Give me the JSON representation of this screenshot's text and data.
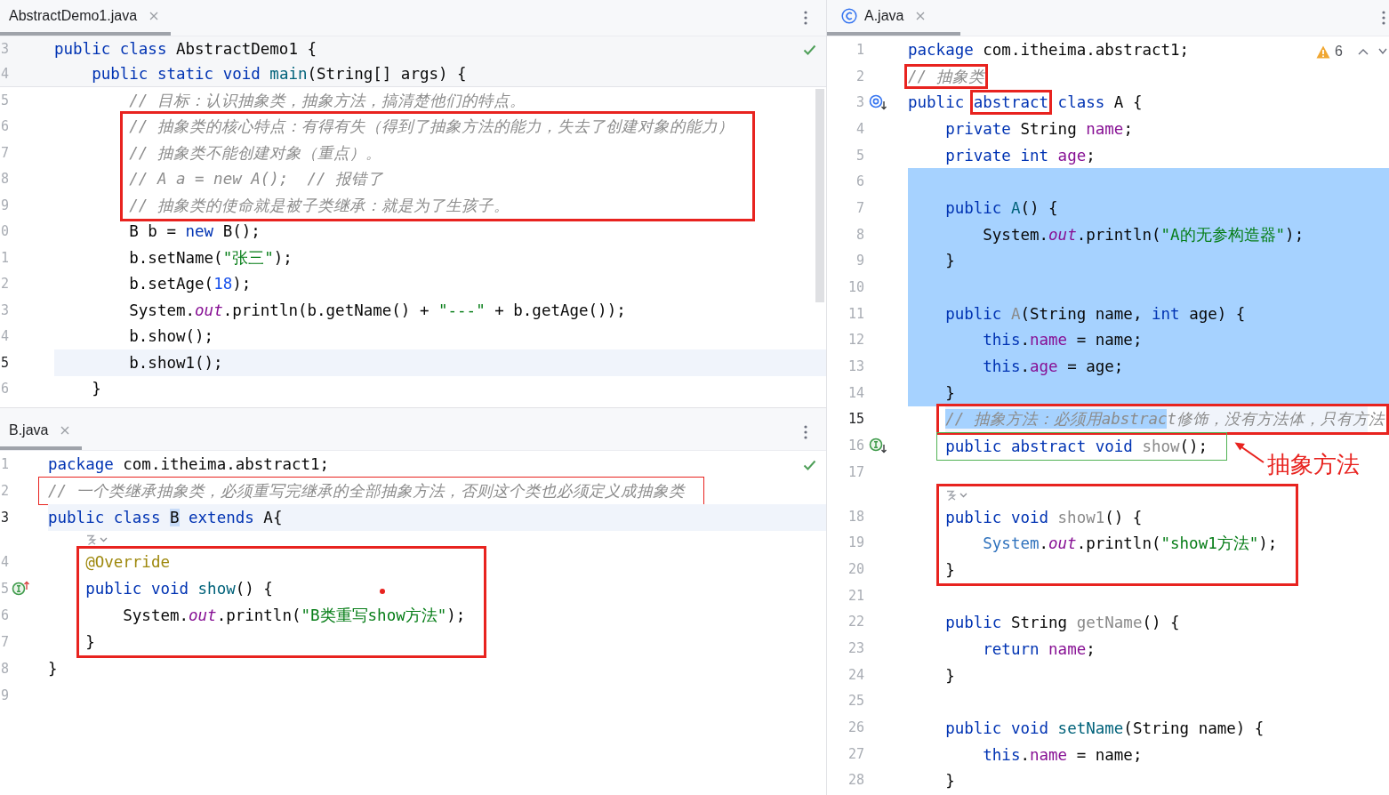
{
  "left_pane": {
    "editors": [
      {
        "tabs": [
          {
            "label": "AbstractDemo1.java",
            "selected": true
          }
        ],
        "inspection": {
          "kind": "ok"
        },
        "sticky_lines": [
          {
            "kind": "code",
            "number": "3",
            "tokens": [
              {
                "kind": "keyword",
                "text": "public class"
              },
              {
                "kind": "plain",
                "text": " AbstractDemo1 {"
              }
            ]
          },
          {
            "kind": "code",
            "number": "4",
            "tokens": [
              {
                "kind": "keyword",
                "text": "    public static void "
              },
              {
                "kind": "declaration",
                "text": "main"
              },
              {
                "kind": "plain",
                "text": "(String[] args) {"
              }
            ]
          }
        ],
        "lines": [
          {
            "kind": "code",
            "number": "5",
            "current": false,
            "tokens": [
              {
                "kind": "comment",
                "text": "        // 目标：认识抽象类，抽象方法，搞清楚他们的特点。"
              }
            ]
          },
          {
            "kind": "frame",
            "color": "#e8231f",
            "lines": [
              {
                "kind": "code",
                "number": "6",
                "current": false,
                "tokens": [
                  {
                    "kind": "comment",
                    "text": "        // 抽象类的核心特点：有得有失（得到了抽象方法的能力，失去了创建对象的能力）"
                  }
                ]
              },
              {
                "kind": "code",
                "number": "7",
                "current": false,
                "tokens": [
                  {
                    "kind": "comment",
                    "text": "        // 抽象类不能创建对象（重点）。"
                  }
                ]
              },
              {
                "kind": "code",
                "number": "8",
                "current": false,
                "tokens": [
                  {
                    "kind": "comment",
                    "text": "        // A a = new A();  // 报错了"
                  }
                ]
              },
              {
                "kind": "code",
                "number": "9",
                "current": false,
                "tokens": [
                  {
                    "kind": "comment",
                    "text": "        // 抽象类的使命就是被子类继承：就是为了生孩子。"
                  }
                ]
              }
            ]
          },
          {
            "kind": "code",
            "number": "0",
            "current": false,
            "tokens": [
              {
                "kind": "plain",
                "text": "        B b = "
              },
              {
                "kind": "keyword",
                "text": "new"
              },
              {
                "kind": "plain",
                "text": " B();"
              }
            ]
          },
          {
            "kind": "code",
            "number": "1",
            "current": false,
            "tokens": [
              {
                "kind": "plain",
                "text": "        b.setName("
              },
              {
                "kind": "string",
                "text": "\"张三\""
              },
              {
                "kind": "plain",
                "text": ");"
              }
            ]
          },
          {
            "kind": "code",
            "number": "2",
            "current": false,
            "tokens": [
              {
                "kind": "plain",
                "text": "        b.setAge("
              },
              {
                "kind": "number",
                "text": "18"
              },
              {
                "kind": "plain",
                "text": ");"
              }
            ]
          },
          {
            "kind": "code",
            "number": "3",
            "current": false,
            "tokens": [
              {
                "kind": "plain",
                "text": "        System."
              },
              {
                "kind": "static-field",
                "text": "out"
              },
              {
                "kind": "plain",
                "text": ".println(b.getName() + "
              },
              {
                "kind": "string",
                "text": "\"---\""
              },
              {
                "kind": "plain",
                "text": " + b.getAge());"
              }
            ]
          },
          {
            "kind": "code",
            "number": "4",
            "current": false,
            "tokens": [
              {
                "kind": "plain",
                "text": "        b.show();"
              }
            ]
          },
          {
            "kind": "code",
            "number": "5",
            "current": true,
            "tokens": [
              {
                "kind": "plain",
                "text": "        b.show1();"
              }
            ]
          },
          {
            "kind": "code",
            "number": "6",
            "current": false,
            "tokens": [
              {
                "kind": "plain",
                "text": "    }"
              }
            ]
          }
        ]
      },
      {
        "tabs": [
          {
            "label": "B.java",
            "selected": true
          }
        ],
        "inspection": {
          "kind": "ok"
        },
        "lines": [
          {
            "kind": "code",
            "number": "1",
            "current": false,
            "tokens": [
              {
                "kind": "keyword",
                "text": "package"
              },
              {
                "kind": "plain",
                "text": " com.itheima.abstract1;"
              }
            ]
          },
          {
            "kind": "outline",
            "color": "#e8231f",
            "lines": [
              {
                "kind": "code",
                "number": "2",
                "current": false,
                "tokens": [
                  {
                    "kind": "comment",
                    "text": "// 一个类继承抽象类，必须重写完继承的全部抽象方法，否则这个类也必须定义成抽象类"
                  }
                ]
              }
            ]
          },
          {
            "kind": "code",
            "number": "3",
            "current": true,
            "tokens": [
              {
                "kind": "keyword",
                "text": "public class "
              },
              {
                "kind": "caret-word",
                "text": "B"
              },
              {
                "kind": "keyword",
                "text": " extends"
              },
              {
                "kind": "plain",
                "text": " A{"
              }
            ]
          },
          {
            "kind": "hint",
            "current": false
          },
          {
            "kind": "frame",
            "color": "#e8231f",
            "lines": [
              {
                "kind": "code",
                "number": "4",
                "current": false,
                "tokens": [
                  {
                    "kind": "annotation",
                    "text": "    @Override"
                  }
                ]
              },
              {
                "kind": "code",
                "number": "5",
                "current": false,
                "marker": {
                  "kind": "implements"
                },
                "tokens": [
                  {
                    "kind": "keyword",
                    "text": "    public void "
                  },
                  {
                    "kind": "declaration",
                    "text": "show"
                  },
                  {
                    "kind": "plain",
                    "text": "() {"
                  }
                ]
              },
              {
                "kind": "code",
                "number": "6",
                "current": false,
                "tokens": [
                  {
                    "kind": "plain",
                    "text": "        System."
                  },
                  {
                    "kind": "static-field",
                    "text": "out"
                  },
                  {
                    "kind": "plain",
                    "text": ".println("
                  },
                  {
                    "kind": "string",
                    "text": "\"B类重写show方法\""
                  },
                  {
                    "kind": "plain",
                    "text": ");"
                  }
                ]
              },
              {
                "kind": "code",
                "number": "7",
                "current": false,
                "tokens": [
                  {
                    "kind": "plain",
                    "text": "    }"
                  }
                ]
              }
            ]
          },
          {
            "kind": "code",
            "number": "8",
            "current": false,
            "tokens": [
              {
                "kind": "plain",
                "text": "}"
              }
            ]
          },
          {
            "kind": "code",
            "number": "9",
            "current": false
          }
        ]
      }
    ]
  },
  "right_pane": {
    "editors": [
      {
        "tabs": [
          {
            "label": "A.java",
            "selected": true,
            "icon": {
              "kind": "class"
            }
          }
        ],
        "inspection": {
          "kind": "warnings",
          "count": "6"
        },
        "lines": [
          {
            "kind": "code",
            "number": "1",
            "current": false,
            "selected": false,
            "tokens": [
              {
                "kind": "keyword",
                "text": "package"
              },
              {
                "kind": "plain",
                "text": " com.itheima.abstract1;"
              }
            ]
          },
          {
            "kind": "code",
            "number": "2",
            "current": false,
            "selected": false,
            "tokens": [
              {
                "kind": "frame",
                "color": "#e8231f",
                "tokens": [
                  {
                    "kind": "comment",
                    "text": "// 抽象类"
                  }
                ]
              }
            ]
          },
          {
            "kind": "code",
            "number": "3",
            "current": false,
            "selected": false,
            "marker": {
              "kind": "subclassed"
            },
            "tokens": [
              {
                "kind": "keyword",
                "text": "public "
              },
              {
                "kind": "frame",
                "color": "#e8231f",
                "tokens": [
                  {
                    "kind": "keyword",
                    "text": "abstract"
                  }
                ]
              },
              {
                "kind": "keyword",
                "text": " class"
              },
              {
                "kind": "plain",
                "text": " A {"
              }
            ]
          },
          {
            "kind": "code",
            "number": "4",
            "current": false,
            "selected": false,
            "tokens": [
              {
                "kind": "keyword",
                "text": "    private"
              },
              {
                "kind": "plain",
                "text": " String "
              },
              {
                "kind": "field",
                "text": "name"
              },
              {
                "kind": "plain",
                "text": ";"
              }
            ]
          },
          {
            "kind": "code",
            "number": "5",
            "current": false,
            "selected": false,
            "tokens": [
              {
                "kind": "keyword",
                "text": "    private int "
              },
              {
                "kind": "field",
                "text": "age"
              },
              {
                "kind": "plain",
                "text": ";"
              }
            ]
          },
          {
            "kind": "code",
            "number": "6",
            "current": false,
            "selected": true
          },
          {
            "kind": "code",
            "number": "7",
            "current": false,
            "selected": true,
            "tokens": [
              {
                "kind": "keyword",
                "text": "    public "
              },
              {
                "kind": "declaration",
                "text": "A"
              },
              {
                "kind": "plain",
                "text": "() {"
              }
            ]
          },
          {
            "kind": "code",
            "number": "8",
            "current": false,
            "selected": true,
            "tokens": [
              {
                "kind": "plain",
                "text": "        System."
              },
              {
                "kind": "static-field",
                "text": "out"
              },
              {
                "kind": "plain",
                "text": ".println("
              },
              {
                "kind": "string",
                "text": "\"A的无参构造器\""
              },
              {
                "kind": "plain",
                "text": ");"
              }
            ]
          },
          {
            "kind": "code",
            "number": "9",
            "current": false,
            "selected": true,
            "tokens": [
              {
                "kind": "plain",
                "text": "    }"
              }
            ]
          },
          {
            "kind": "code",
            "number": "10",
            "current": false,
            "selected": true
          },
          {
            "kind": "code",
            "number": "11",
            "current": false,
            "selected": true,
            "tokens": [
              {
                "kind": "keyword",
                "text": "    public "
              },
              {
                "kind": "unused",
                "text": "A"
              },
              {
                "kind": "plain",
                "text": "(String name, "
              },
              {
                "kind": "keyword",
                "text": "int"
              },
              {
                "kind": "plain",
                "text": " age) {"
              }
            ]
          },
          {
            "kind": "code",
            "number": "12",
            "current": false,
            "selected": true,
            "tokens": [
              {
                "kind": "keyword",
                "text": "        this"
              },
              {
                "kind": "plain",
                "text": "."
              },
              {
                "kind": "field",
                "text": "name"
              },
              {
                "kind": "plain",
                "text": " = name;"
              }
            ]
          },
          {
            "kind": "code",
            "number": "13",
            "current": false,
            "selected": true,
            "tokens": [
              {
                "kind": "keyword",
                "text": "        this"
              },
              {
                "kind": "plain",
                "text": "."
              },
              {
                "kind": "field",
                "text": "age"
              },
              {
                "kind": "plain",
                "text": " = age;"
              }
            ]
          },
          {
            "kind": "code",
            "number": "14",
            "current": false,
            "selected": true,
            "tokens": [
              {
                "kind": "plain",
                "text": "    }"
              }
            ]
          },
          {
            "kind": "frame",
            "color": "#e8231f",
            "lines": [
              {
                "kind": "code",
                "number": "15",
                "current": true,
                "selected": false,
                "tokens": [
                  {
                    "kind": "comment",
                    "text": "    // 抽象方法：必须用abstrac",
                    "selected": true
                  },
                  {
                    "kind": "comment",
                    "text": "t修饰，没有方法体，只有方法",
                    "selected": false
                  }
                ]
              }
            ]
          },
          {
            "kind": "outline",
            "color": "#52b355",
            "lines": [
              {
                "kind": "code",
                "number": "16",
                "current": false,
                "selected": false,
                "marker": {
                  "kind": "implemented"
                },
                "tokens": [
                  {
                    "kind": "keyword",
                    "text": "    public abstract void "
                  },
                  {
                    "kind": "unused",
                    "text": "show"
                  },
                  {
                    "kind": "plain",
                    "text": "();"
                  }
                ]
              }
            ]
          },
          {
            "kind": "code",
            "number": "17",
            "current": false,
            "selected": false
          },
          {
            "kind": "frame",
            "color": "#e8231f",
            "lines": [
              {
                "kind": "hint",
                "current": false,
                "selected": false
              },
              {
                "kind": "code",
                "number": "18",
                "current": false,
                "selected": false,
                "tokens": [
                  {
                    "kind": "keyword",
                    "text": "    public void "
                  },
                  {
                    "kind": "unused",
                    "text": "show1"
                  },
                  {
                    "kind": "plain",
                    "text": "() {"
                  }
                ]
              },
              {
                "kind": "code",
                "number": "19",
                "current": false,
                "selected": false,
                "tokens": [
                  {
                    "kind": "usage",
                    "text": "        System"
                  },
                  {
                    "kind": "plain",
                    "text": "."
                  },
                  {
                    "kind": "static-field",
                    "text": "out"
                  },
                  {
                    "kind": "plain",
                    "text": ".println("
                  },
                  {
                    "kind": "string",
                    "text": "\"show1方法\""
                  },
                  {
                    "kind": "plain",
                    "text": ");"
                  }
                ]
              },
              {
                "kind": "code",
                "number": "20",
                "current": false,
                "selected": false,
                "tokens": [
                  {
                    "kind": "plain",
                    "text": "    }"
                  }
                ]
              }
            ]
          },
          {
            "kind": "code",
            "number": "21",
            "current": false,
            "selected": false
          },
          {
            "kind": "code",
            "number": "22",
            "current": false,
            "selected": false,
            "tokens": [
              {
                "kind": "keyword",
                "text": "    public"
              },
              {
                "kind": "plain",
                "text": " String "
              },
              {
                "kind": "unused",
                "text": "getName"
              },
              {
                "kind": "plain",
                "text": "() {"
              }
            ]
          },
          {
            "kind": "code",
            "number": "23",
            "current": false,
            "selected": false,
            "tokens": [
              {
                "kind": "keyword",
                "text": "        return "
              },
              {
                "kind": "field",
                "text": "name"
              },
              {
                "kind": "plain",
                "text": ";"
              }
            ]
          },
          {
            "kind": "code",
            "number": "24",
            "current": false,
            "selected": false,
            "tokens": [
              {
                "kind": "plain",
                "text": "    }"
              }
            ]
          },
          {
            "kind": "code",
            "number": "25",
            "current": false,
            "selected": false
          },
          {
            "kind": "code",
            "number": "26",
            "current": false,
            "selected": false,
            "tokens": [
              {
                "kind": "keyword",
                "text": "    public void "
              },
              {
                "kind": "declaration",
                "text": "setName"
              },
              {
                "kind": "plain",
                "text": "(String name) {"
              }
            ]
          },
          {
            "kind": "code",
            "number": "27",
            "current": false,
            "selected": false,
            "tokens": [
              {
                "kind": "keyword",
                "text": "        this"
              },
              {
                "kind": "plain",
                "text": "."
              },
              {
                "kind": "field",
                "text": "name"
              },
              {
                "kind": "plain",
                "text": " = name;"
              }
            ]
          },
          {
            "kind": "code",
            "number": "28",
            "current": false,
            "selected": false,
            "tokens": [
              {
                "kind": "plain",
                "text": "    }"
              }
            ]
          }
        ],
        "callouts": [
          {
            "text": "抽象方法"
          }
        ]
      }
    ]
  }
}
